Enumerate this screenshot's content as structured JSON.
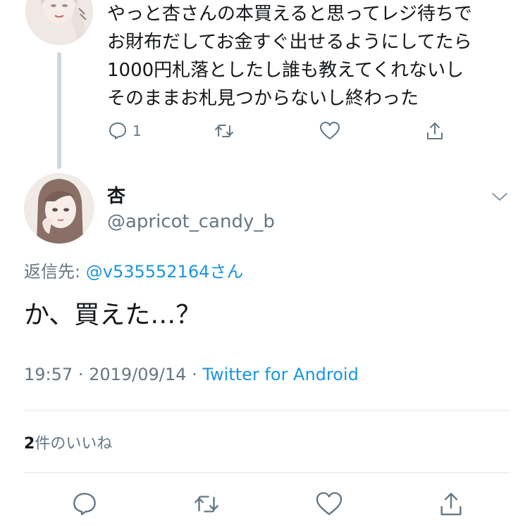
{
  "parent_tweet": {
    "text": "やっと杏さんの本買えると思ってレジ待ちで\nお財布だしてお金すぐ出せるようにしてたら\n1000円札落としたし誰も教えてくれないし\nそのままお札見つからないし終わった",
    "reply_count": "1",
    "avatar_icon": "user-avatar-illustration"
  },
  "tweet": {
    "display_name": "杏",
    "handle": "@apricot_candy_b",
    "reply_to_label": "返信先:",
    "reply_to_user": "@v535552164さん",
    "body": "か、買えた…？",
    "time": "19:57",
    "date": "2019/09/14",
    "separator": "·",
    "source": "Twitter for Android",
    "like_count": "2",
    "like_label": "件のいいね"
  },
  "colors": {
    "primary_text": "#14171a",
    "secondary_text": "#657786",
    "link": "#1b95e0",
    "divider": "#e1e8ed",
    "thread_line": "#cfd9de"
  },
  "icons": [
    "reply-icon",
    "retweet-icon",
    "like-icon",
    "share-icon",
    "chevron-down-icon"
  ]
}
